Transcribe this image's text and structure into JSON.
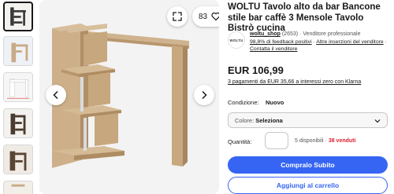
{
  "listing": {
    "title": "WOLTU Tavolo alto da bar Bancone stile bar caffè 3 Mensole Tavolo Bistrò cucina",
    "watchers": "83",
    "price": "EUR 106,99",
    "installments": "3 pagamenti da EUR 35,66 a interessi zero con Klarna"
  },
  "seller": {
    "logo_text": "WOLTU",
    "name": "woltu_shop",
    "count": "(2653)",
    "separator": "·",
    "badge": "Venditore professionale",
    "feedback": "98,8% di feedback positivi",
    "sep1": " · ",
    "other_items": "Altre inserzioni del venditore",
    "sep2": " · ",
    "contact": "Contatta il venditore"
  },
  "condition": {
    "label": "Condizione:",
    "value": "Nuovo"
  },
  "color_select": {
    "label": "Colore:",
    "value": "Seleziona"
  },
  "quantity": {
    "label": "Quantità:",
    "value": "",
    "available": "5 disponibili",
    "separator": " · ",
    "sold": "38 venduti"
  },
  "actions": {
    "buy_now": "Compralo Subito",
    "add_to_cart": "Aggiungi al carrello"
  },
  "icons": {
    "expand": "expand-icon",
    "heart": "heart-icon",
    "prev": "chevron-left-icon",
    "next": "chevron-right-icon",
    "dropdown": "chevron-down-icon"
  },
  "colors": {
    "accent": "#3665f3",
    "sold_red": "#dd1e31",
    "wood": "#c9ab86"
  }
}
